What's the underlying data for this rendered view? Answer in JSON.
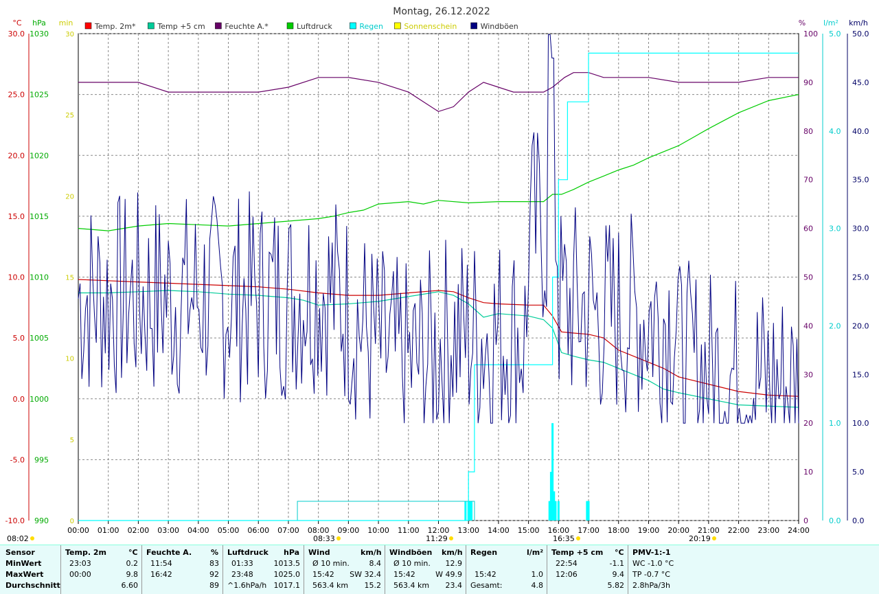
{
  "chart_data": {
    "type": "line",
    "title": "Montag, 26.12.2022",
    "x_range": [
      "00:00",
      "24:00"
    ],
    "x_ticks": [
      "00:00",
      "01:00",
      "02:00",
      "03:00",
      "04:00",
      "05:00",
      "06:00",
      "07:00",
      "08:00",
      "09:00",
      "10:00",
      "11:00",
      "12:00",
      "13:00",
      "14:00",
      "15:00",
      "16:00",
      "17:00",
      "18:00",
      "19:00",
      "20:00",
      "21:00",
      "22:00",
      "23:00",
      "24:00"
    ],
    "axes": {
      "temp": {
        "unit": "°C",
        "range": [
          -10.0,
          30.0
        ],
        "ticks": [
          "-10.0",
          "-5.0",
          "0.0",
          "5.0",
          "10.0",
          "15.0",
          "20.0",
          "25.0",
          "30.0"
        ],
        "color": "#cc0000"
      },
      "pressure": {
        "unit": "hPa",
        "range": [
          990,
          1030
        ],
        "ticks": [
          "990",
          "995",
          "1000",
          "1005",
          "1010",
          "1015",
          "1020",
          "1025",
          "1030"
        ],
        "color": "#00aa00"
      },
      "sunshine": {
        "unit": "min",
        "range": [
          0,
          30
        ],
        "ticks": [
          "0",
          "5",
          "10",
          "15",
          "20",
          "25",
          "30"
        ],
        "color": "#cccc00"
      },
      "humidity": {
        "unit": "%",
        "range": [
          0,
          100
        ],
        "ticks": [
          "0",
          "10",
          "20",
          "30",
          "40",
          "50",
          "60",
          "70",
          "80",
          "90",
          "100"
        ],
        "color": "#660066"
      },
      "rain": {
        "unit": "l/m²",
        "range": [
          0.0,
          5.0
        ],
        "ticks": [
          "0.0",
          "1.0",
          "2.0",
          "3.0",
          "4.0",
          "5.0"
        ],
        "color": "#00cccc"
      },
      "wind": {
        "unit": "km/h",
        "range": [
          0.0,
          50.0
        ],
        "ticks": [
          "0.0",
          "5.0",
          "10.0",
          "15.0",
          "20.0",
          "25.0",
          "30.0",
          "35.0",
          "40.0",
          "45.0",
          "50.0"
        ],
        "color": "#000066"
      }
    },
    "legend": [
      {
        "name": "Temp. 2m*",
        "color": "#ff0000"
      },
      {
        "name": "Temp +5 cm",
        "color": "#00cc99"
      },
      {
        "name": "Feuchte A.*",
        "color": "#660066"
      },
      {
        "name": "Luftdruck",
        "color": "#00cc00"
      },
      {
        "name": "Regen",
        "color": "#00ffff"
      },
      {
        "name": "Sonnenschein",
        "color": "#ffff00"
      },
      {
        "name": "Windböen",
        "color": "#000080"
      }
    ],
    "series": [
      {
        "name": "Temp. 2m*",
        "axis": "temp",
        "color": "#cc0000",
        "x": [
          0,
          1,
          2,
          3,
          4,
          5,
          6,
          7,
          8,
          9,
          10,
          11,
          12,
          12.5,
          13,
          13.5,
          14,
          15,
          15.5,
          15.8,
          16.1,
          16.5,
          17,
          17.5,
          18,
          18.5,
          19,
          19.5,
          20,
          21,
          22,
          23,
          24
        ],
        "y": [
          9.8,
          9.7,
          9.6,
          9.5,
          9.4,
          9.3,
          9.2,
          9.0,
          8.7,
          8.5,
          8.5,
          8.7,
          8.9,
          8.8,
          8.3,
          7.9,
          7.8,
          7.7,
          7.7,
          6.8,
          5.5,
          5.4,
          5.3,
          5.0,
          4.0,
          3.5,
          3.0,
          2.5,
          1.8,
          1.2,
          0.6,
          0.3,
          0.2
        ]
      },
      {
        "name": "Temp +5 cm",
        "axis": "temp",
        "color": "#00cc99",
        "x": [
          0,
          1,
          2,
          3,
          4,
          5,
          6,
          7,
          7.5,
          8,
          9,
          10,
          11,
          12,
          12.5,
          13,
          13.5,
          14,
          15,
          15.5,
          15.8,
          16.1,
          16.5,
          17,
          17.5,
          18,
          18.5,
          19,
          19.5,
          20,
          21,
          22,
          23,
          24
        ],
        "y": [
          8.7,
          8.7,
          8.8,
          8.9,
          8.8,
          8.6,
          8.5,
          8.3,
          8.1,
          7.7,
          7.8,
          8.0,
          8.4,
          8.8,
          8.5,
          7.8,
          6.7,
          7.0,
          6.8,
          6.5,
          5.8,
          3.8,
          3.5,
          3.2,
          3.0,
          2.5,
          2.0,
          1.5,
          0.8,
          0.5,
          0.0,
          -0.5,
          -0.6,
          -0.7
        ]
      },
      {
        "name": "Feuchte A.*",
        "axis": "humidity",
        "color": "#660066",
        "x": [
          0,
          1,
          2,
          3,
          4,
          5,
          6,
          7,
          8,
          9,
          10,
          11,
          11.5,
          12,
          12.5,
          13,
          13.5,
          14,
          14.5,
          15,
          15.5,
          15.8,
          16.2,
          16.5,
          17,
          17.5,
          18,
          19,
          20,
          21,
          22,
          23,
          24
        ],
        "y": [
          90,
          90,
          90,
          88,
          88,
          88,
          88,
          89,
          91,
          91,
          90,
          88,
          86,
          84,
          85,
          88,
          90,
          89,
          88,
          88,
          88,
          89,
          91,
          92,
          92,
          91,
          91,
          91,
          90,
          90,
          90,
          91,
          91
        ]
      },
      {
        "name": "Luftdruck",
        "axis": "pressure",
        "color": "#00cc00",
        "x": [
          0,
          1,
          2,
          3,
          4,
          5,
          6,
          7,
          8,
          8.5,
          9,
          9.5,
          10,
          11,
          11.5,
          12,
          13,
          14,
          15,
          15.5,
          15.8,
          16.1,
          16.5,
          17,
          17.5,
          18,
          18.5,
          19,
          20,
          21,
          22,
          23,
          24
        ],
        "y": [
          1014.0,
          1013.8,
          1014.2,
          1014.4,
          1014.3,
          1014.2,
          1014.4,
          1014.6,
          1014.8,
          1015.0,
          1015.3,
          1015.5,
          1016.0,
          1016.2,
          1016.0,
          1016.3,
          1016.1,
          1016.2,
          1016.2,
          1016.2,
          1016.8,
          1016.8,
          1017.2,
          1017.8,
          1018.3,
          1018.8,
          1019.2,
          1019.8,
          1020.8,
          1022.2,
          1023.5,
          1024.5,
          1025.0
        ]
      },
      {
        "name": "Regen",
        "axis": "rain",
        "color": "#00ffff",
        "x": [
          0,
          12.8,
          13.0,
          13.2,
          15.7,
          15.8,
          16.0,
          16.3,
          16.9,
          17.0,
          24
        ],
        "y": [
          0,
          0,
          0.5,
          1.6,
          1.6,
          2.5,
          3.5,
          4.3,
          4.3,
          4.8,
          4.8
        ]
      },
      {
        "name": "Windböen",
        "axis": "wind",
        "color": "#000080",
        "seed_points": "gust series, mean 23.4 km/h, max 49.9 km/h at 15:42"
      }
    ]
  },
  "markers": {
    "sunrise": "08:33",
    "noon": "11:29",
    "sunset": "16:35",
    "moonset": "20:19",
    "left_marker": "08:02"
  },
  "stats": {
    "header": {
      "sensor": "Sensor",
      "temp": "Temp. 2m",
      "temp_unit": "°C",
      "hum": "Feuchte A.",
      "hum_unit": "%",
      "press": "Luftdruck",
      "press_unit": "hPa",
      "wind": "Wind",
      "wind_unit": "km/h",
      "gust": "Windböen",
      "gust_unit": "km/h",
      "rain": "Regen",
      "rain_unit": "l/m²",
      "t5": "Temp +5 cm",
      "t5_unit": "°C",
      "pmv": "PMV-1:-1"
    },
    "min": {
      "label": "MinWert",
      "temp_time": "23:03",
      "temp": "0.2",
      "hum_time": "11:54",
      "hum": "83",
      "press_time": "01:33",
      "press": "1013.5",
      "wind_label": "Ø 10 min.",
      "wind": "8.4",
      "gust_label": "Ø 10 min.",
      "gust": "12.9",
      "t5_time": "22:54",
      "t5": "-1.1",
      "pmv": "WC -1.0 °C"
    },
    "max": {
      "label": "MaxWert",
      "temp_time": "00:00",
      "temp": "9.8",
      "hum_time": "16:42",
      "hum": "92",
      "press_time": "23:48",
      "press": "1025.0",
      "wind_time": "15:42",
      "wind_dir": "SW 32.4",
      "gust_time": "15:42",
      "gust_dir": "W 49.9",
      "rain_time": "15:42",
      "rain": "1.0",
      "t5_time": "12:06",
      "t5": "9.4",
      "pmv": "TP -0.7 °C"
    },
    "avg": {
      "label": "Durchschnitt",
      "temp": "6.60",
      "hum": "89",
      "press_trend": "^1.6hPa/h",
      "press": "1017.1",
      "wind_dist": "563.4 km",
      "wind": "15.2",
      "gust_dist": "563.4 km",
      "gust": "23.4",
      "rain_label": "Gesamt:",
      "rain": "4.8",
      "t5": "5.82",
      "pmv": "2.8hPa/3h"
    }
  }
}
